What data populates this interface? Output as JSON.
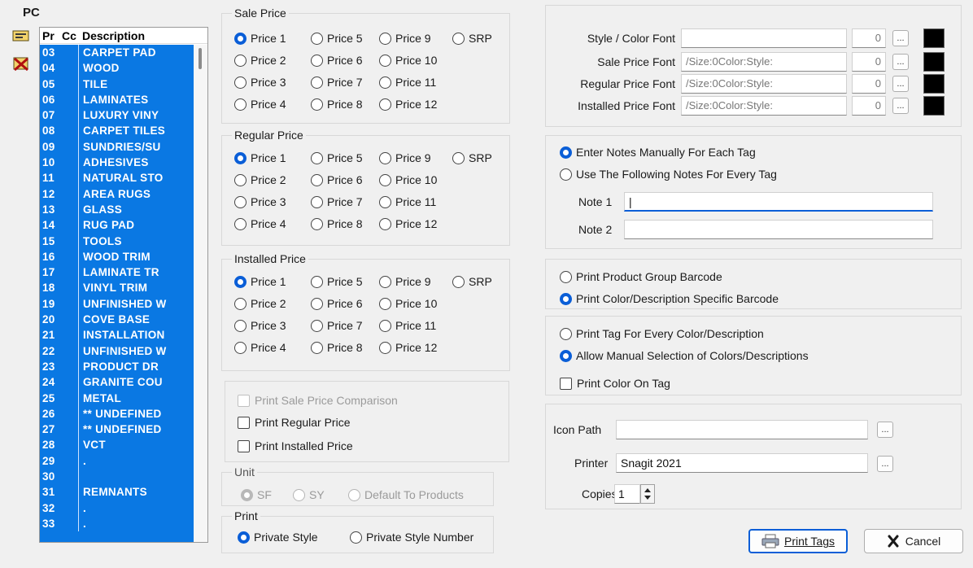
{
  "left_panel": {
    "title": "PC",
    "columns": [
      "Pr",
      "Cc",
      "Description"
    ],
    "rows": [
      {
        "code": "03",
        "desc": "CARPET PAD"
      },
      {
        "code": "04",
        "desc": "WOOD"
      },
      {
        "code": "05",
        "desc": "TILE"
      },
      {
        "code": "06",
        "desc": "LAMINATES"
      },
      {
        "code": "07",
        "desc": "LUXURY VINY"
      },
      {
        "code": "08",
        "desc": "CARPET TILES"
      },
      {
        "code": "09",
        "desc": "SUNDRIES/SU"
      },
      {
        "code": "10",
        "desc": "ADHESIVES"
      },
      {
        "code": "11",
        "desc": "NATURAL STO"
      },
      {
        "code": "12",
        "desc": "AREA RUGS"
      },
      {
        "code": "13",
        "desc": "GLASS"
      },
      {
        "code": "14",
        "desc": "RUG PAD"
      },
      {
        "code": "15",
        "desc": "TOOLS"
      },
      {
        "code": "16",
        "desc": "WOOD TRIM"
      },
      {
        "code": "17",
        "desc": "LAMINATE TR"
      },
      {
        "code": "18",
        "desc": "VINYL TRIM"
      },
      {
        "code": "19",
        "desc": "UNFINISHED W"
      },
      {
        "code": "20",
        "desc": "COVE BASE"
      },
      {
        "code": "21",
        "desc": "INSTALLATION"
      },
      {
        "code": "22",
        "desc": "UNFINISHED W"
      },
      {
        "code": "23",
        "desc": "PRODUCT DR"
      },
      {
        "code": "24",
        "desc": "GRANITE COU"
      },
      {
        "code": "25",
        "desc": "METAL"
      },
      {
        "code": "26",
        "desc": "** UNDEFINED"
      },
      {
        "code": "27",
        "desc": "** UNDEFINED"
      },
      {
        "code": "28",
        "desc": "VCT"
      },
      {
        "code": "29",
        "desc": "."
      },
      {
        "code": "30",
        "desc": ""
      },
      {
        "code": "31",
        "desc": "REMNANTS"
      },
      {
        "code": "32",
        "desc": "."
      },
      {
        "code": "33",
        "desc": "."
      }
    ]
  },
  "sale_price": {
    "title": "Sale Price",
    "options": [
      "Price 1",
      "Price 5",
      "Price 9",
      "SRP",
      "Price 2",
      "Price 6",
      "Price 10",
      "Price 3",
      "Price 7",
      "Price 11",
      "Price 4",
      "Price 8",
      "Price 12"
    ]
  },
  "regular_price": {
    "title": "Regular Price",
    "options": [
      "Price 1",
      "Price 5",
      "Price 9",
      "SRP",
      "Price 2",
      "Price 6",
      "Price 10",
      "Price 3",
      "Price 7",
      "Price 11",
      "Price 4",
      "Price 8",
      "Price 12"
    ]
  },
  "installed_price": {
    "title": "Installed Price",
    "options": [
      "Price 1",
      "Price 5",
      "Price 9",
      "SRP",
      "Price 2",
      "Price 6",
      "Price 10",
      "Price 3",
      "Price 7",
      "Price 11",
      "Price 4",
      "Price 8",
      "Price 12"
    ]
  },
  "print_checks": {
    "sale_comparison": "Print Sale Price Comparison",
    "regular": "Print Regular Price",
    "installed": "Print Installed Price"
  },
  "unit": {
    "title": "Unit",
    "sf": "SF",
    "sy": "SY",
    "default": "Default To Products"
  },
  "print_style": {
    "title": "Print",
    "private_style": "Private Style",
    "private_style_number": "Private Style Number"
  },
  "fonts": {
    "style_color": {
      "label": "Style / Color Font",
      "value": "",
      "size": "0"
    },
    "sale": {
      "label": "Sale Price Font",
      "value": "/Size:0Color:Style:",
      "size": "0"
    },
    "regular": {
      "label": "Regular Price Font",
      "value": "/Size:0Color:Style:",
      "size": "0"
    },
    "installed": {
      "label": "Installed Price Font",
      "value": "/Size:0Color:Style:",
      "size": "0"
    },
    "ellipsis": "..."
  },
  "notes": {
    "manual": "Enter Notes Manually For Each Tag",
    "following": "Use The Following Notes For Every Tag",
    "note1_label": "Note 1",
    "note1_value": "|",
    "note2_label": "Note 2",
    "note2_value": ""
  },
  "barcode": {
    "group": "Print Product Group Barcode",
    "specific": "Print Color/Description Specific Barcode"
  },
  "tags": {
    "every": "Print Tag For Every Color/Description",
    "manual": "Allow Manual Selection of Colors/Descriptions",
    "color_on_tag": "Print Color On Tag"
  },
  "output": {
    "icon_path_label": "Icon Path",
    "icon_path_value": "",
    "printer_label": "Printer",
    "printer_value": "Snagit 2021",
    "copies_label": "Copies",
    "copies_value": "1"
  },
  "buttons": {
    "print": "Print Tags",
    "cancel": "Cancel"
  },
  "colors": {
    "selection": "#0a78e3",
    "accent": "#0a5ed7",
    "cancel_icon": "#1a1a1a"
  }
}
